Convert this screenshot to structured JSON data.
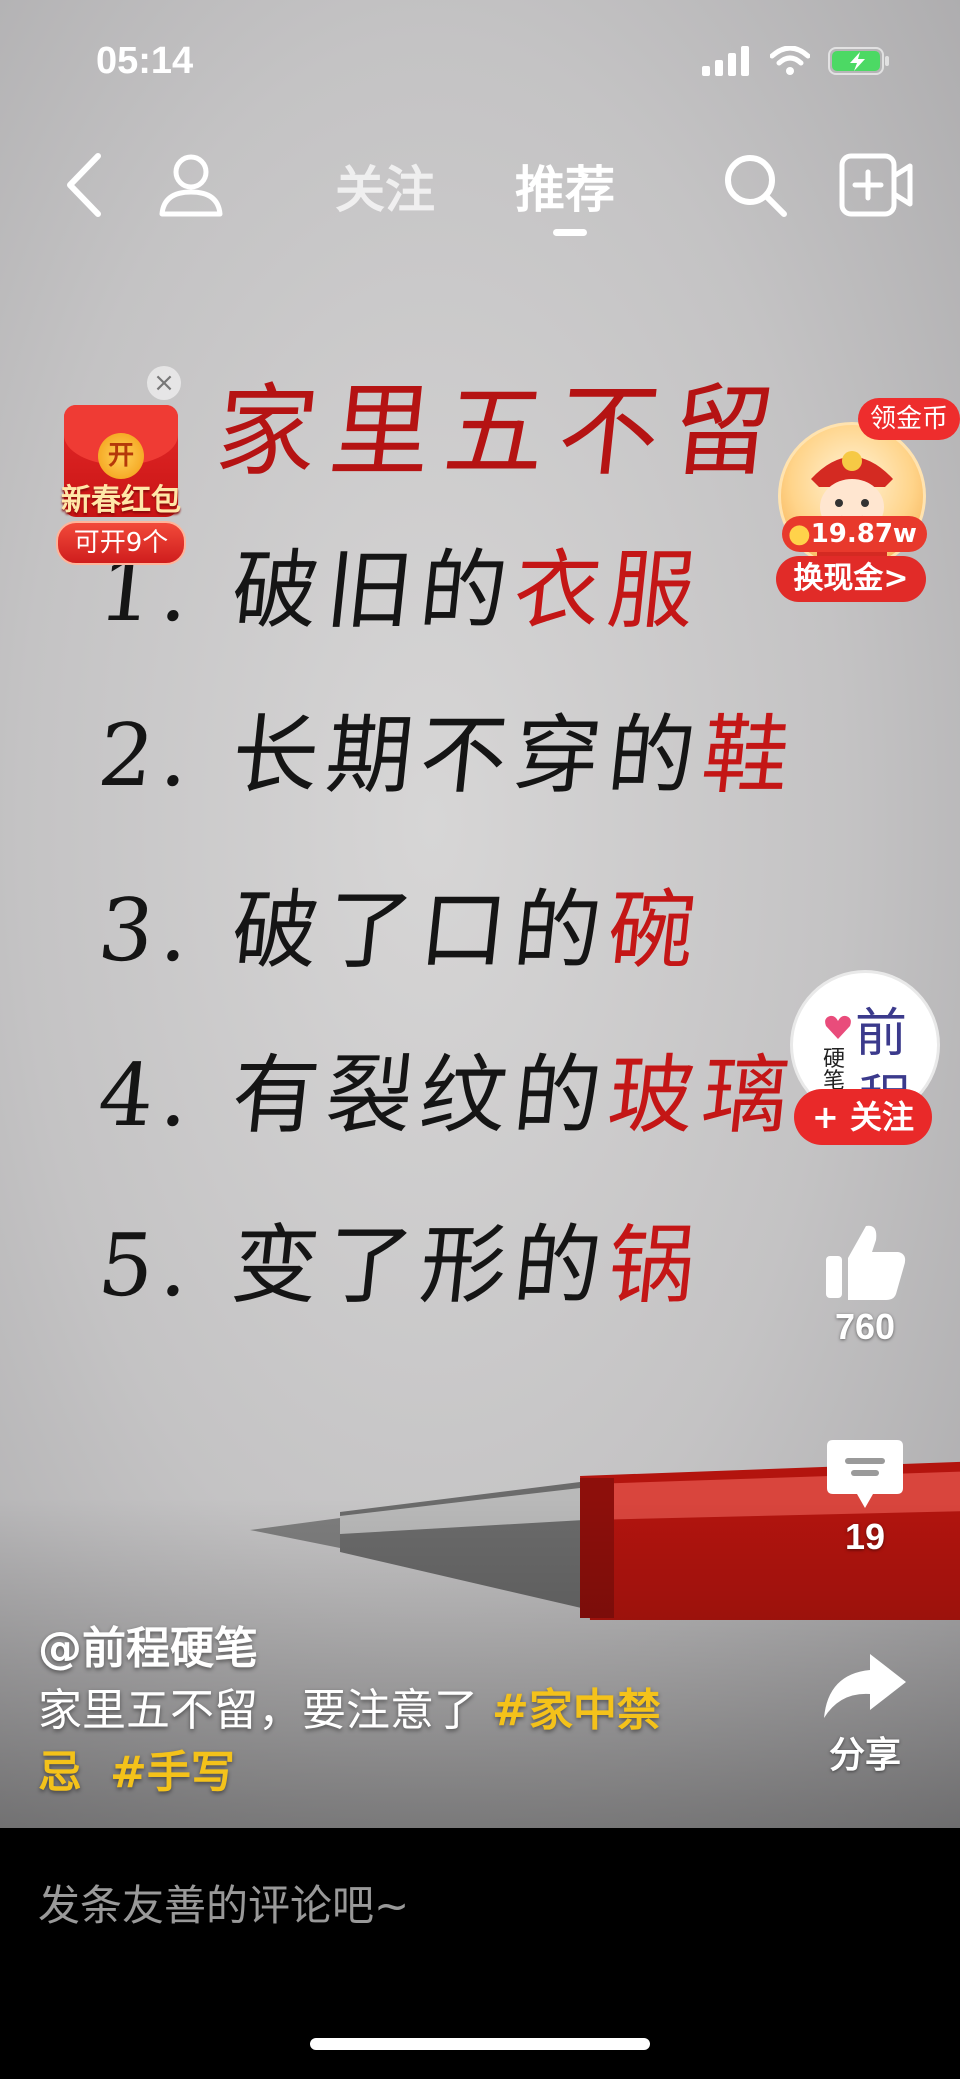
{
  "status_bar": {
    "time": "05:14"
  },
  "top_nav": {
    "tab_follow": "关注",
    "tab_recommend": "推荐"
  },
  "video": {
    "paper_title": "家里五不留",
    "lines": [
      {
        "black": "1. 破旧的",
        "red": "衣服"
      },
      {
        "black": "2. 长期不穿的",
        "red": "鞋"
      },
      {
        "black": "3. 破了口的",
        "red": "碗"
      },
      {
        "black": "4. 有裂纹的",
        "red": "玻璃"
      },
      {
        "black": "5. 变了形的",
        "red": "锅"
      }
    ]
  },
  "red_envelope": {
    "coin_char": "开",
    "label": "新春红包",
    "count": "可开9个",
    "close": "×"
  },
  "coin_widget": {
    "badge": "领金币",
    "amount": "19.87w",
    "cash": "换现金>"
  },
  "author": {
    "avatar_big1": "前",
    "avatar_small": "硬笔",
    "avatar_big2": "程",
    "follow": "+ 关注"
  },
  "actions": {
    "likes": "760",
    "comments": "19",
    "share": "分享"
  },
  "caption": {
    "author": "@前程硬笔",
    "text": "家里五不留，要注意了 ",
    "tag1": "#家中禁忌",
    "tag2": "#手写"
  },
  "comment_bar": {
    "placeholder": "发条友善的评论吧~"
  }
}
